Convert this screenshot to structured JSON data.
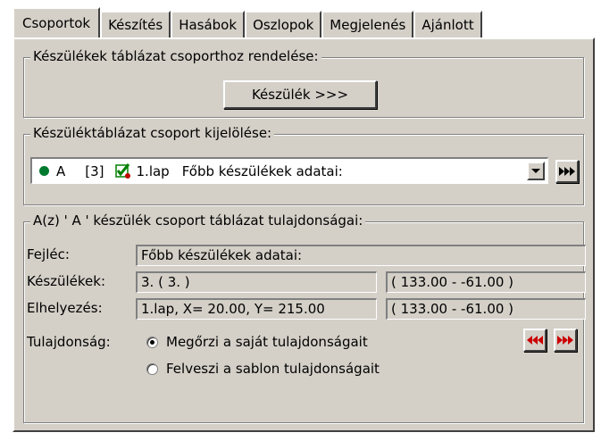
{
  "tabs": [
    {
      "label": "Csoportok",
      "active": true
    },
    {
      "label": "Készítés",
      "active": false
    },
    {
      "label": "Hasábok",
      "active": false
    },
    {
      "label": "Oszlopok",
      "active": false
    },
    {
      "label": "Megjelenés",
      "active": false
    },
    {
      "label": "Ajánlott",
      "active": false
    }
  ],
  "assign_group": {
    "title": "Készülékek táblázat csoporthoz rendelése:",
    "button_label": "Készülék >>>"
  },
  "select_group": {
    "title": "Készüléktáblázat csoport kijelölése:",
    "combo": {
      "letter": "A",
      "index": "[3]",
      "page": "1.lap",
      "header": "Főbb készülékek adatai:"
    }
  },
  "properties": {
    "title": "A(z) ' A ' készülék csoport táblázat tulajdonságai:",
    "header_label": "Fejléc:",
    "header_value": "Főbb készülékek adatai:",
    "devices_label": "Készülékek:",
    "devices_value": "3.  ( 3. )",
    "devices_coord": "( 133.00 -  -61.00 )",
    "placement_label": "Elhelyezés:",
    "placement_value": "1.lap, X=  20.00, Y= 215.00",
    "placement_coord": "( 133.00 -  -61.00 )",
    "property_label": "Tulajdonság:",
    "radio_keep": "Megőrzi a saját tulajdonságait",
    "radio_take": "Felveszi a sablon tulajdonságait",
    "selected": "keep"
  },
  "colors": {
    "face": "#d4d0c8",
    "green_dot": "#007a2e",
    "red_arrow": "#cc0000"
  }
}
